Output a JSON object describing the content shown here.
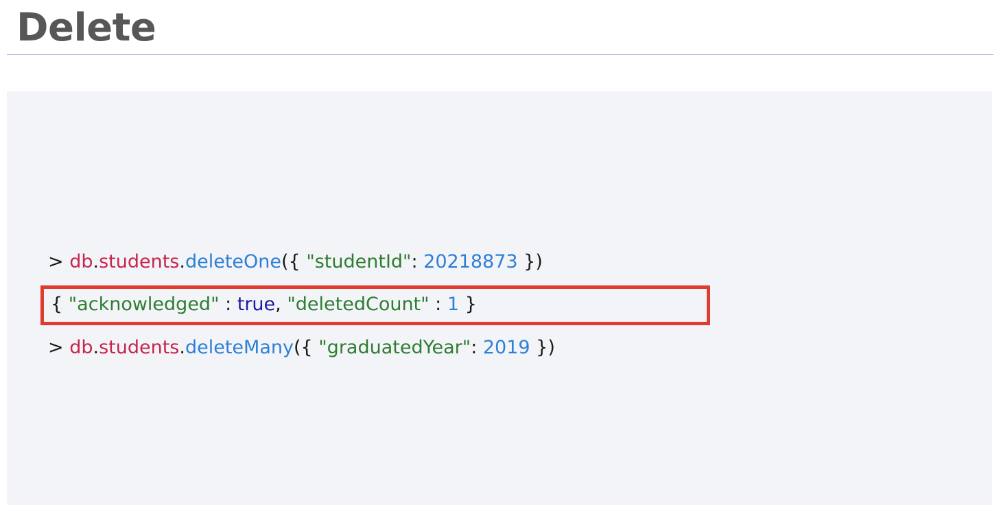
{
  "slide": {
    "title": "Delete"
  },
  "code": {
    "line1": {
      "prompt": ">",
      "db": "db",
      "dot1": ".",
      "collection": "students",
      "dot2": ".",
      "method": "deleteOne",
      "open": "({ ",
      "key": "\"studentId\"",
      "colon": ": ",
      "value": "20218873",
      "close": " })"
    },
    "line2": {
      "open": "{ ",
      "key1": "\"acknowledged\"",
      "colon1": " : ",
      "value1": "true",
      "comma": ", ",
      "key2": "\"deletedCount\"",
      "colon2": " : ",
      "value2": "1",
      "close": " }"
    },
    "line3": {
      "prompt": ">",
      "db": "db",
      "dot1": ".",
      "collection": "students",
      "dot2": ".",
      "method": "deleteMany",
      "open": "({ ",
      "key": "\"graduatedYear\"",
      "colon": ": ",
      "value": "2019",
      "close": " })"
    }
  },
  "colors": {
    "highlight_border": "#e03b2f",
    "db_object": "#c7254e",
    "method": "#2e7fd6",
    "string": "#2e7d32",
    "boolean": "#1a1aa6"
  }
}
